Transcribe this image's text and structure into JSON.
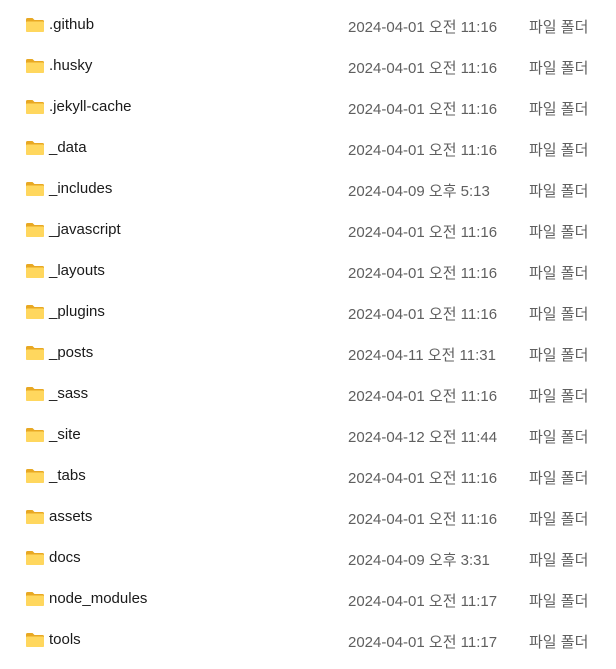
{
  "colors": {
    "folder_back": "#e8a823",
    "folder_front": "#ffd75e",
    "text_primary": "#1a1a1a",
    "text_secondary": "#5f5f5f"
  },
  "files": [
    {
      "name": ".github",
      "date": "2024-04-01 오전 11:16",
      "type": "파일 폴더",
      "icon": "folder-icon"
    },
    {
      "name": ".husky",
      "date": "2024-04-01 오전 11:16",
      "type": "파일 폴더",
      "icon": "folder-icon"
    },
    {
      "name": ".jekyll-cache",
      "date": "2024-04-01 오전 11:16",
      "type": "파일 폴더",
      "icon": "folder-icon"
    },
    {
      "name": "_data",
      "date": "2024-04-01 오전 11:16",
      "type": "파일 폴더",
      "icon": "folder-icon"
    },
    {
      "name": "_includes",
      "date": "2024-04-09 오후 5:13",
      "type": "파일 폴더",
      "icon": "folder-icon"
    },
    {
      "name": "_javascript",
      "date": "2024-04-01 오전 11:16",
      "type": "파일 폴더",
      "icon": "folder-icon"
    },
    {
      "name": "_layouts",
      "date": "2024-04-01 오전 11:16",
      "type": "파일 폴더",
      "icon": "folder-icon"
    },
    {
      "name": "_plugins",
      "date": "2024-04-01 오전 11:16",
      "type": "파일 폴더",
      "icon": "folder-icon"
    },
    {
      "name": "_posts",
      "date": "2024-04-11 오전 11:31",
      "type": "파일 폴더",
      "icon": "folder-icon"
    },
    {
      "name": "_sass",
      "date": "2024-04-01 오전 11:16",
      "type": "파일 폴더",
      "icon": "folder-icon"
    },
    {
      "name": "_site",
      "date": "2024-04-12 오전 11:44",
      "type": "파일 폴더",
      "icon": "folder-icon"
    },
    {
      "name": "_tabs",
      "date": "2024-04-01 오전 11:16",
      "type": "파일 폴더",
      "icon": "folder-icon"
    },
    {
      "name": "assets",
      "date": "2024-04-01 오전 11:16",
      "type": "파일 폴더",
      "icon": "folder-icon"
    },
    {
      "name": "docs",
      "date": "2024-04-09 오후 3:31",
      "type": "파일 폴더",
      "icon": "folder-icon"
    },
    {
      "name": "node_modules",
      "date": "2024-04-01 오전 11:17",
      "type": "파일 폴더",
      "icon": "folder-icon"
    },
    {
      "name": "tools",
      "date": "2024-04-01 오전 11:17",
      "type": "파일 폴더",
      "icon": "folder-icon"
    }
  ]
}
